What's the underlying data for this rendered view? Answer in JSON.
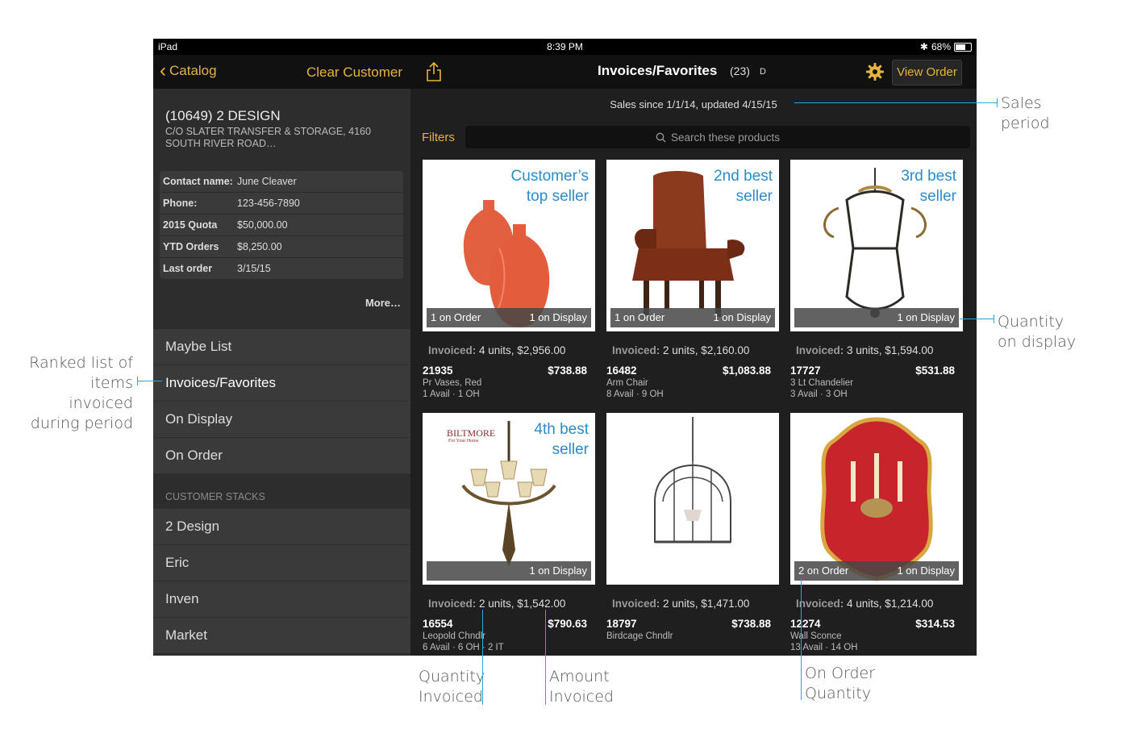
{
  "status_bar": {
    "device": "iPad",
    "time": "8:39 PM",
    "battery": "68%",
    "battery_level": 0.68
  },
  "left_nav": {
    "back_label": "Catalog",
    "clear_label": "Clear Customer"
  },
  "customer": {
    "name": "(10649) 2 DESIGN",
    "address": "C/O SLATER TRANSFER & STORAGE, 4160 SOUTH RIVER ROAD…",
    "info": [
      {
        "key": "Contact name:",
        "value": "June Cleaver"
      },
      {
        "key": "Phone:",
        "value": "123-456-7890"
      },
      {
        "key": "2015 Quota",
        "value": "$50,000.00"
      },
      {
        "key": "YTD Orders",
        "value": "$8,250.00"
      },
      {
        "key": "Last order",
        "value": "3/15/15"
      }
    ],
    "more_label": "More…"
  },
  "menu": [
    "Maybe List",
    "Invoices/Favorites",
    "On Display",
    "On Order"
  ],
  "stacks_header": "CUSTOMER STACKS",
  "stacks": [
    "2 Design",
    "Eric",
    "Inven",
    "Market"
  ],
  "right_nav": {
    "title": "Invoices/Favorites",
    "count": "(23)",
    "sort": "D",
    "view_order_label": "View Order"
  },
  "sales_period": "Sales since 1/1/14, updated 4/15/15",
  "filters_label": "Filters",
  "search_placeholder": "Search these products",
  "products": [
    {
      "callout": [
        "Customer’s",
        "top seller"
      ],
      "on_order": "1 on Order",
      "on_display": "1 on Display",
      "invoiced_label": "Invoiced:",
      "invoiced": "4 units, $2,956.00",
      "sku": "21935",
      "price": "$738.88",
      "desc": "Pr Vases, Red",
      "avail": "1 Avail · 1 OH"
    },
    {
      "callout": [
        "2nd best",
        "seller"
      ],
      "on_order": "1 on Order",
      "on_display": "1 on Display",
      "invoiced_label": "Invoiced:",
      "invoiced": "2 units, $2,160.00",
      "sku": "16482",
      "price": "$1,083.88",
      "desc": "Arm Chair",
      "avail": "8 Avail · 9 OH"
    },
    {
      "callout": [
        "3rd best",
        "seller"
      ],
      "on_order": "",
      "on_display": "1 on Display",
      "invoiced_label": "Invoiced:",
      "invoiced": "3 units, $1,594.00",
      "sku": "17727",
      "price": "$531.88",
      "desc": "3 Lt Chandelier",
      "avail": "3 Avail · 3 OH"
    },
    {
      "callout": [
        "4th best",
        "seller"
      ],
      "on_order": "",
      "on_display": "1 on Display",
      "invoiced_label": "Invoiced:",
      "invoiced": "2 units, $1,542.00",
      "sku": "16554",
      "price": "$790.63",
      "desc": "Leopold Chndlr",
      "avail": "6 Avail · 6 OH · 2 IT",
      "brand": "BILTMORE",
      "brand_sub": "For Your Home"
    },
    {
      "callout": [],
      "on_order": "",
      "on_display": "",
      "invoiced_label": "Invoiced:",
      "invoiced": "2 units, $1,471.00",
      "sku": "18797",
      "price": "$738.88",
      "desc": "Birdcage Chndlr",
      "avail": ""
    },
    {
      "callout": [],
      "on_order": "2 on Order",
      "on_display": "1 on Display",
      "invoiced_label": "Invoiced:",
      "invoiced": "4 units, $1,214.00",
      "sku": "12274",
      "price": "$314.53",
      "desc": "Wall Sconce",
      "avail": "13 Avail · 14 OH"
    }
  ],
  "annotations": {
    "sales_period": [
      "Sales",
      "period"
    ],
    "quantity_on_display": [
      "Quantity",
      "on display"
    ],
    "ranked_list": [
      "Ranked list of",
      "items invoiced",
      "during period"
    ],
    "quantity_invoiced": [
      "Quantity",
      "Invoiced"
    ],
    "amount_invoiced": [
      "Amount",
      "Invoiced"
    ],
    "on_order_quantity": [
      "On Order",
      "Quantity"
    ]
  },
  "colors": {
    "accent": "#e6b43a",
    "callout": "#2b8cc8",
    "annotation_line": "#2aa7d8"
  }
}
